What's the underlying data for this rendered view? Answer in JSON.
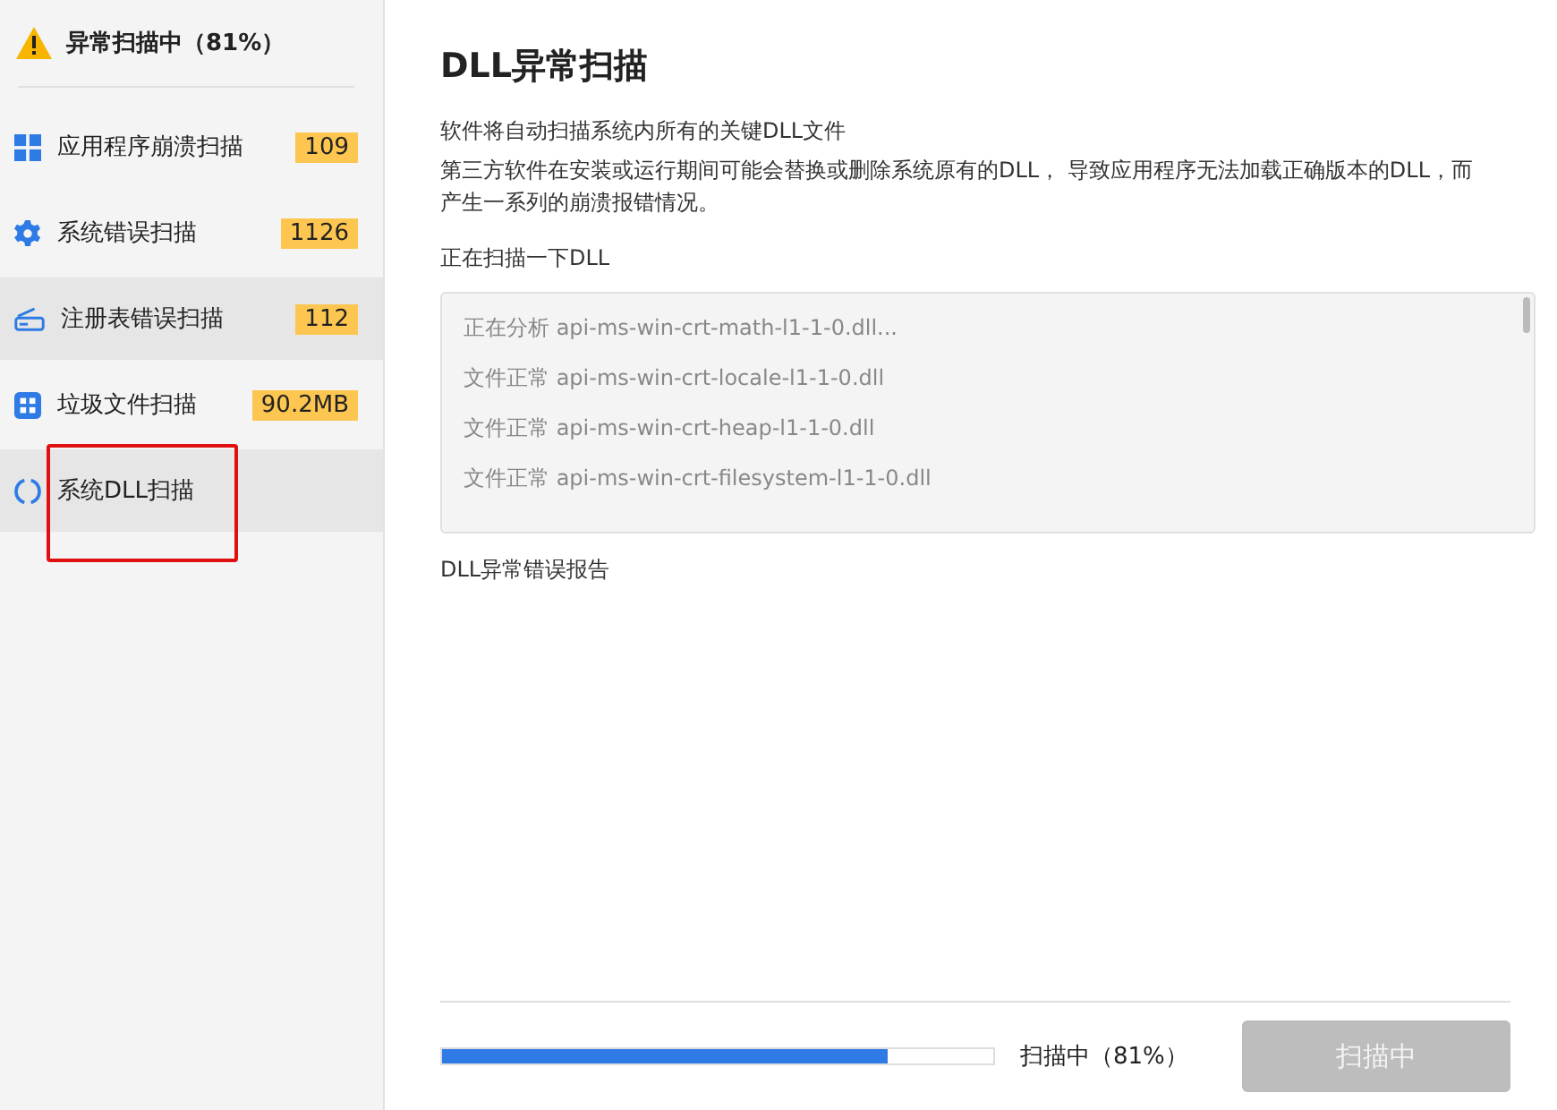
{
  "sidebar": {
    "header": {
      "title": "异常扫描中（81%）"
    },
    "items": [
      {
        "kind": "apps",
        "label": "应用程序崩溃扫描",
        "count": "109",
        "highlighted": false
      },
      {
        "kind": "gear",
        "label": "系统错误扫描",
        "count": "1126",
        "highlighted": false
      },
      {
        "kind": "registry",
        "label": "注册表错误扫描",
        "count": "112",
        "highlighted": true
      },
      {
        "kind": "junk",
        "label": "垃圾文件扫描",
        "count": "90.2MB",
        "highlighted": false
      },
      {
        "kind": "refresh",
        "label": "系统DLL扫描",
        "highlighted": true
      }
    ]
  },
  "main": {
    "title": "DLL异常扫描",
    "description": [
      "软件将自动扫描系统内所有的关键DLL文件",
      "第三方软件在安装或运行期间可能会替换或删除系统原有的DLL， 导致应用程序无法加载正确版本的DLL，而产生一系列的崩溃报错情况。"
    ],
    "log_label": "正在扫描一下DLL",
    "log": [
      "正在分析 api-ms-win-crt-math-l1-1-0.dll...",
      "文件正常 api-ms-win-crt-locale-l1-1-0.dll",
      "文件正常 api-ms-win-crt-heap-l1-1-0.dll",
      "文件正常 api-ms-win-crt-filesystem-l1-1-0.dll"
    ],
    "report_label": "DLL异常错误报告",
    "progress": {
      "level": 0.81,
      "status": "扫描中（81%）"
    },
    "button": {
      "label": "扫描中",
      "disabled": true
    }
  }
}
